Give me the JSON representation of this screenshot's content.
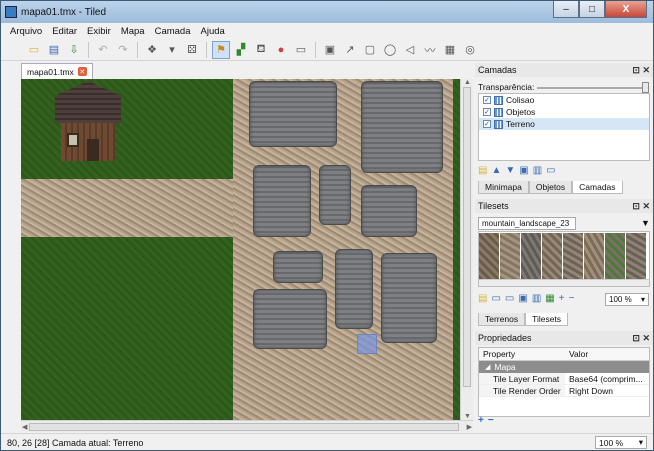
{
  "window": {
    "title": "mapa01.tmx - Tiled",
    "min": "–",
    "max": "□",
    "close": "X"
  },
  "menu": [
    "Arquivo",
    "Editar",
    "Exibir",
    "Mapa",
    "Camada",
    "Ajuda"
  ],
  "toolbar": {
    "tools": [
      "new-map",
      "open",
      "save",
      "undo",
      "redo",
      "stamp-group",
      "random",
      "stamp-brush",
      "terrain-brush",
      "bucket-fill",
      "eraser",
      "rect-select",
      "select-objects",
      "edit-polygons",
      "insert-rect",
      "insert-ellipse",
      "insert-polygon",
      "insert-polyline",
      "insert-tile",
      "insert-image"
    ],
    "active_tool": "stamp-brush"
  },
  "document": {
    "tab_label": "mapa01.tmx"
  },
  "status": {
    "text": "80, 26 [28]  Camada atual: Terreno",
    "zoom": "100 %"
  },
  "layers_panel": {
    "title": "Camadas",
    "transparency_label": "Transparência:",
    "transparency": 1.0,
    "layers": [
      {
        "name": "Colisao",
        "checked": true,
        "selected": false
      },
      {
        "name": "Objetos",
        "checked": true,
        "selected": false
      },
      {
        "name": "Terreno",
        "checked": true,
        "selected": true
      }
    ],
    "tabs": [
      "Minimapa",
      "Objetos",
      "Camadas"
    ],
    "active_tab": "Camadas"
  },
  "tilesets_panel": {
    "title": "Tilesets",
    "current": "mountain_landscape_23",
    "zoom": "100 %",
    "tabs": [
      "Terrenos",
      "Tilesets"
    ],
    "active_tab": "Tilesets"
  },
  "properties_panel": {
    "title": "Propriedades",
    "col_property": "Property",
    "col_value": "Valor",
    "group": "Mapa",
    "rows": [
      {
        "key": "Tile Layer Format",
        "value": "Base64 (comprim..."
      },
      {
        "key": "Tile Render Order",
        "value": "Right Down"
      }
    ]
  },
  "colors": {
    "grass": "#33621f",
    "dirt": "#b6a28a",
    "rock": "#777777",
    "selection": "#7896e6",
    "title_bar": "#9dbbdb"
  }
}
